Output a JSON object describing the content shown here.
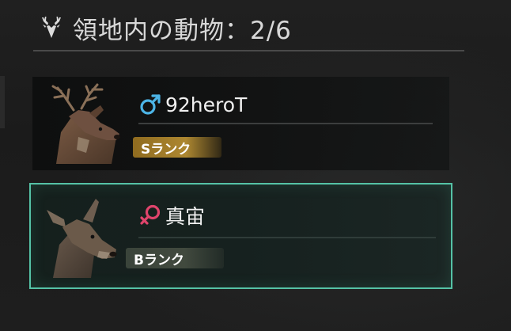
{
  "header": {
    "title": "領地内の動物：2/6",
    "icon": "deer-head-icon"
  },
  "animals": [
    {
      "sex": "male",
      "sex_icon": "male-symbol-icon",
      "sex_color": "#4cb4e6",
      "name": "92heroT",
      "rank": "Sランク",
      "rank_color": "#b08a2e",
      "portrait": "stag-portrait",
      "selected": false
    },
    {
      "sex": "female",
      "sex_icon": "female-symbol-icon",
      "sex_color": "#e0446c",
      "name": "真宙",
      "rank": "Bランク",
      "rank_color": "#4a5446",
      "portrait": "doe-portrait",
      "selected": true,
      "highlight_color": "#55c2a6"
    }
  ]
}
